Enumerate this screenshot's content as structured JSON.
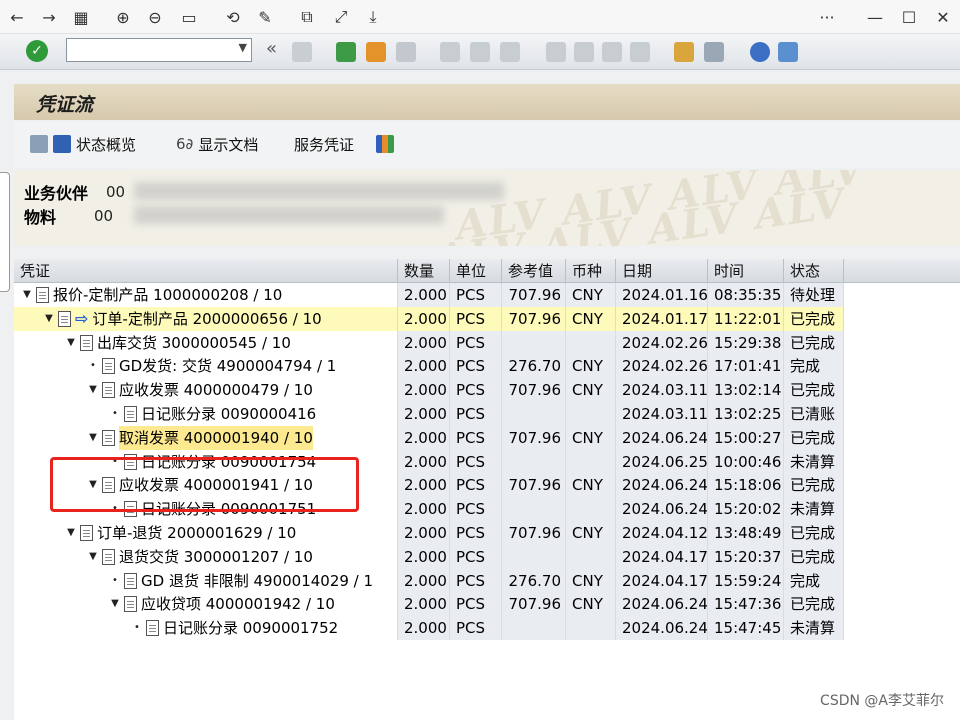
{
  "viewer": {
    "icons": [
      "back-icon",
      "forward-icon",
      "grid-icon",
      "zoom-in-icon",
      "zoom-out-icon",
      "fit-icon",
      "rotate-icon",
      "edit-icon",
      "copy-icon",
      "fullscreen-icon",
      "download-icon"
    ],
    "window_controls": {
      "more": "···",
      "minimize": "—",
      "maximize": "☐",
      "close": "✕"
    }
  },
  "title": "凭证流",
  "toolbar": {
    "status_overview": "状态概览",
    "display_document": "显示文档",
    "service_document": "服务凭证"
  },
  "header": {
    "partner_label": "业务伙伴",
    "partner_value": "00",
    "material_label": "物料",
    "material_value": "00"
  },
  "columns": [
    "凭证",
    "数量",
    "单位",
    "参考值",
    "币种",
    "日期",
    "时间",
    "状态"
  ],
  "rows": [
    {
      "doc": "报价-定制产品 1000000208 / 10",
      "qty": "2.000",
      "unit": "PCS",
      "ref": "707.96",
      "cur": "CNY",
      "date": "2024.01.16",
      "time": "08:35:35",
      "status": "待处理"
    },
    {
      "doc": "订单-定制产品 2000000656 / 10",
      "qty": "2.000",
      "unit": "PCS",
      "ref": "707.96",
      "cur": "CNY",
      "date": "2024.01.17",
      "time": "11:22:01",
      "status": "已完成"
    },
    {
      "doc": "出库交货 3000000545 / 10",
      "qty": "2.000",
      "unit": "PCS",
      "ref": "",
      "cur": "",
      "date": "2024.02.26",
      "time": "15:29:38",
      "status": "已完成"
    },
    {
      "doc": "GD发货: 交货 4900004794 / 1",
      "qty": "2.000",
      "unit": "PCS",
      "ref": "276.70",
      "cur": "CNY",
      "date": "2024.02.26",
      "time": "17:01:41",
      "status": "完成"
    },
    {
      "doc": "应收发票 4000000479 / 10",
      "qty": "2.000",
      "unit": "PCS",
      "ref": "707.96",
      "cur": "CNY",
      "date": "2024.03.11",
      "time": "13:02:14",
      "status": "已完成"
    },
    {
      "doc": "日记账分录 0090000416",
      "qty": "2.000",
      "unit": "PCS",
      "ref": "",
      "cur": "",
      "date": "2024.03.11",
      "time": "13:02:25",
      "status": "已清账"
    },
    {
      "doc": "取消发票 4000001940 / 10",
      "qty": "2.000",
      "unit": "PCS",
      "ref": "707.96",
      "cur": "CNY",
      "date": "2024.06.24",
      "time": "15:00:27",
      "status": "已完成"
    },
    {
      "doc": "日记账分录 0090001754",
      "qty": "2.000",
      "unit": "PCS",
      "ref": "",
      "cur": "",
      "date": "2024.06.25",
      "time": "10:00:46",
      "status": "未清算"
    },
    {
      "doc": "应收发票 4000001941 / 10",
      "qty": "2.000",
      "unit": "PCS",
      "ref": "707.96",
      "cur": "CNY",
      "date": "2024.06.24",
      "time": "15:18:06",
      "status": "已完成"
    },
    {
      "doc": "日记账分录 0090001751",
      "qty": "2.000",
      "unit": "PCS",
      "ref": "",
      "cur": "",
      "date": "2024.06.24",
      "time": "15:20:02",
      "status": "未清算"
    },
    {
      "doc": "订单-退货 2000001629 / 10",
      "qty": "2.000",
      "unit": "PCS",
      "ref": "707.96",
      "cur": "CNY",
      "date": "2024.04.12",
      "time": "13:48:49",
      "status": "已完成"
    },
    {
      "doc": "退货交货 3000001207 / 10",
      "qty": "2.000",
      "unit": "PCS",
      "ref": "",
      "cur": "",
      "date": "2024.04.17",
      "time": "15:20:37",
      "status": "已完成"
    },
    {
      "doc": "GD 退货 非限制 4900014029 / 1",
      "qty": "2.000",
      "unit": "PCS",
      "ref": "276.70",
      "cur": "CNY",
      "date": "2024.04.17",
      "time": "15:59:24",
      "status": "完成"
    },
    {
      "doc": "应收贷项 4000001942 / 10",
      "qty": "2.000",
      "unit": "PCS",
      "ref": "707.96",
      "cur": "CNY",
      "date": "2024.06.24",
      "time": "15:47:36",
      "status": "已完成"
    },
    {
      "doc": "日记账分录 0090001752",
      "qty": "2.000",
      "unit": "PCS",
      "ref": "",
      "cur": "",
      "date": "2024.06.24",
      "time": "15:47:45",
      "status": "未清算"
    }
  ],
  "watermark": "CSDN @A李艾菲尔"
}
